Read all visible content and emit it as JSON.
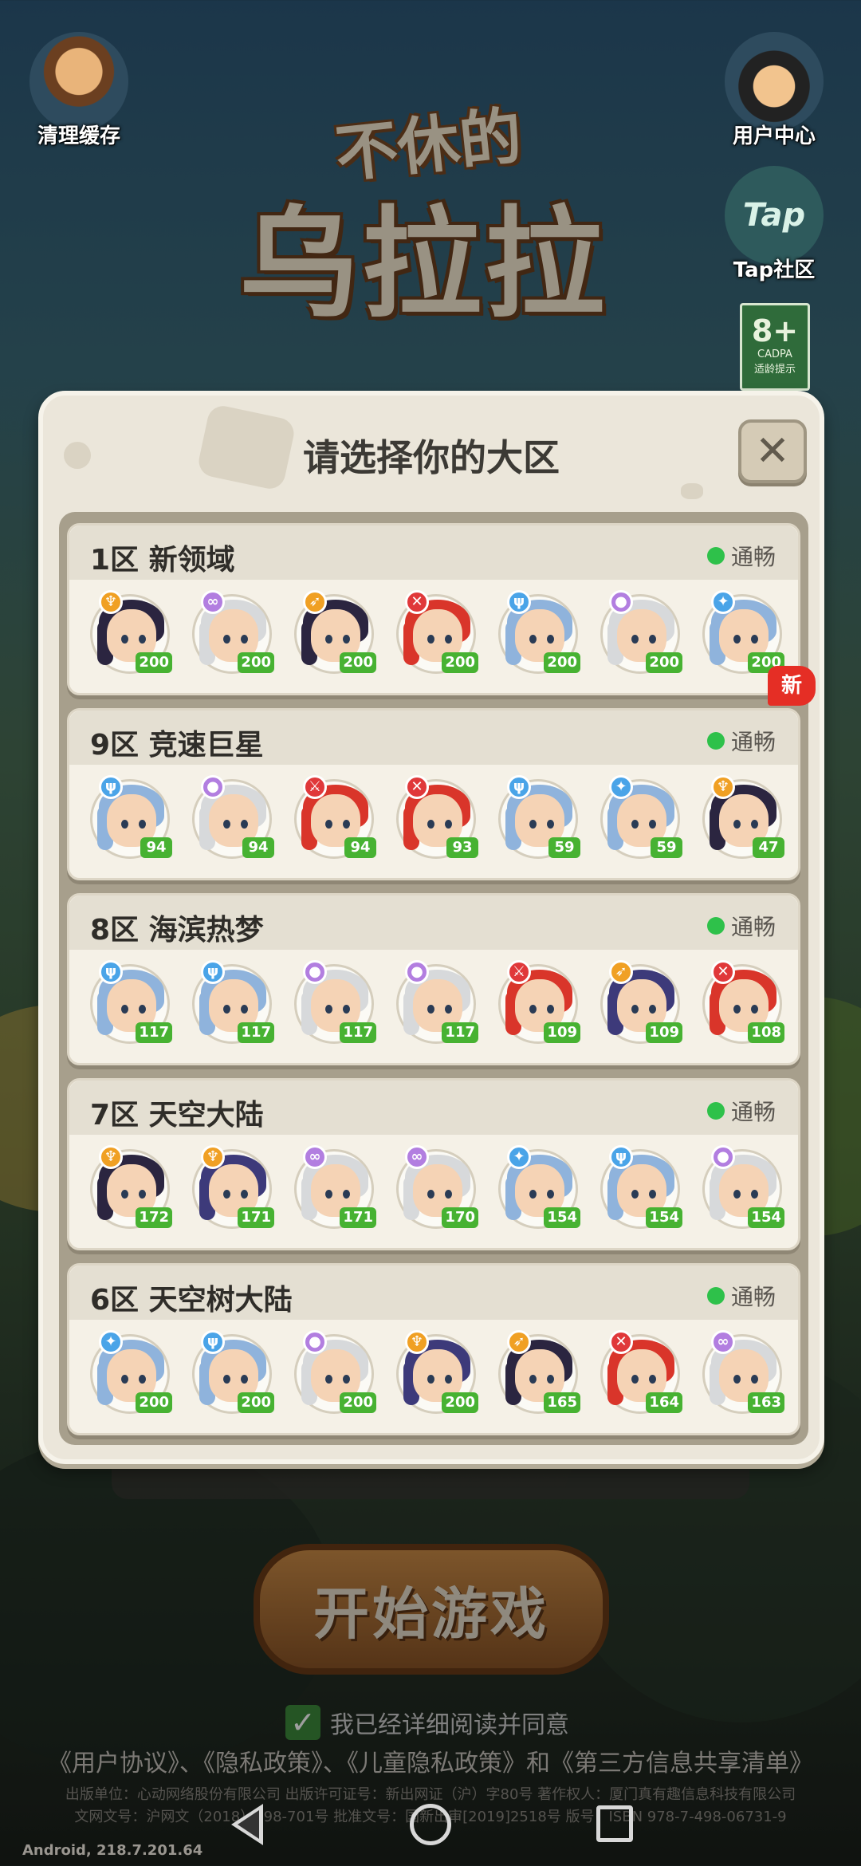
{
  "top": {
    "clear_cache": "清理缓存",
    "user_center": "用户中心",
    "tap_community": "Tap社区",
    "tap_logo": "Tap",
    "age_rating": "8+",
    "age_org": "CADPA",
    "age_note": "适龄提示"
  },
  "logo": {
    "line1": "不休的",
    "line2": "乌拉拉"
  },
  "dialog": {
    "title": "请选择你的大区",
    "close_icon": "close-icon",
    "servers": [
      {
        "name": "1区  新领域",
        "status": "通畅",
        "badge": "新",
        "heroes": [
          {
            "level": "200",
            "cls": "fire",
            "hair": "dark"
          },
          {
            "level": "200",
            "cls": "wind",
            "hair": "silver"
          },
          {
            "level": "200",
            "cls": "arrow",
            "hair": "dark"
          },
          {
            "level": "200",
            "cls": "axe",
            "hair": "red"
          },
          {
            "level": "200",
            "cls": "staff",
            "hair": "blue"
          },
          {
            "level": "200",
            "cls": "orb",
            "hair": "silver"
          },
          {
            "level": "200",
            "cls": "wand",
            "hair": "blue"
          }
        ]
      },
      {
        "name": "9区  竞速巨星",
        "status": "通畅",
        "badge": "",
        "heroes": [
          {
            "level": "94",
            "cls": "staff",
            "hair": "blue"
          },
          {
            "level": "94",
            "cls": "orb",
            "hair": "silver"
          },
          {
            "level": "94",
            "cls": "sword",
            "hair": "red"
          },
          {
            "level": "93",
            "cls": "axe",
            "hair": "red"
          },
          {
            "level": "59",
            "cls": "staff",
            "hair": "blue"
          },
          {
            "level": "59",
            "cls": "wand",
            "hair": "blue"
          },
          {
            "level": "47",
            "cls": "fire",
            "hair": "dark"
          }
        ]
      },
      {
        "name": "8区  海滨热梦",
        "status": "通畅",
        "badge": "",
        "heroes": [
          {
            "level": "117",
            "cls": "staff",
            "hair": "blue"
          },
          {
            "level": "117",
            "cls": "staff",
            "hair": "blue"
          },
          {
            "level": "117",
            "cls": "orb",
            "hair": "silver"
          },
          {
            "level": "117",
            "cls": "orb",
            "hair": "silver"
          },
          {
            "level": "109",
            "cls": "sword",
            "hair": "red"
          },
          {
            "level": "109",
            "cls": "arrow",
            "hair": "navy"
          },
          {
            "level": "108",
            "cls": "axe",
            "hair": "red"
          }
        ]
      },
      {
        "name": "7区  天空大陆",
        "status": "通畅",
        "badge": "",
        "heroes": [
          {
            "level": "172",
            "cls": "fire",
            "hair": "dark"
          },
          {
            "level": "171",
            "cls": "fire",
            "hair": "navy"
          },
          {
            "level": "171",
            "cls": "wind",
            "hair": "silver"
          },
          {
            "level": "170",
            "cls": "wind",
            "hair": "silver"
          },
          {
            "level": "154",
            "cls": "wand",
            "hair": "blue"
          },
          {
            "level": "154",
            "cls": "staff",
            "hair": "blue"
          },
          {
            "level": "154",
            "cls": "orb",
            "hair": "silver"
          }
        ]
      },
      {
        "name": "6区  天空树大陆",
        "status": "通畅",
        "badge": "",
        "heroes": [
          {
            "level": "200",
            "cls": "wand",
            "hair": "blue"
          },
          {
            "level": "200",
            "cls": "staff",
            "hair": "blue"
          },
          {
            "level": "200",
            "cls": "orb",
            "hair": "silver"
          },
          {
            "level": "200",
            "cls": "fire",
            "hair": "navy"
          },
          {
            "level": "165",
            "cls": "arrow",
            "hair": "dark"
          },
          {
            "level": "164",
            "cls": "axe",
            "hair": "red"
          },
          {
            "level": "163",
            "cls": "wind",
            "hair": "silver"
          }
        ]
      }
    ]
  },
  "start_button": "开始游戏",
  "agree": {
    "text": "我已经详细阅读并同意",
    "checked": true
  },
  "policy_links": "《用户协议》、《隐私政策》、《儿童隐私政策》和《第三方信息共享清单》",
  "fine_print": {
    "line1": "出版单位：心动网络股份有限公司 出版许可证号：新出网证（沪）字80号 著作权人：厦门真有趣信息科技有限公司",
    "line2": "文网文号：沪网文（2018）298-701号 批准文号：国新出审[2019]2518号 版号：ISBN 978-7-498-06731-9"
  },
  "version": "Android, 218.7.201.64",
  "colors": {
    "status_ok": "#2ec14a",
    "level_badge": "#47b232",
    "new_badge": "#e52e25",
    "panel_bg": "#ebe6da"
  }
}
